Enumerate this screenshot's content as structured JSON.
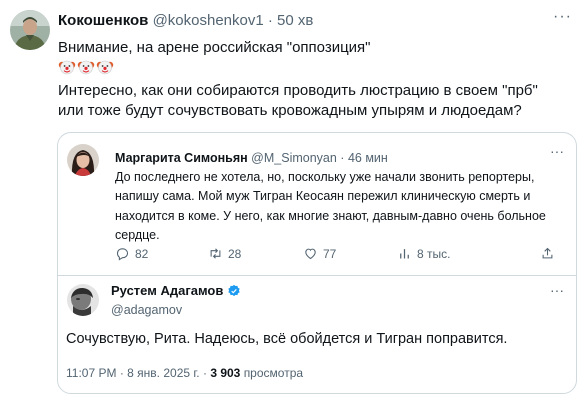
{
  "tweet": {
    "author_name": "Кокошенков",
    "author_handle": "@kokoshenkov1",
    "separator": "·",
    "time": "50 хв",
    "line1": "Внимание, на арене российская \"оппозиция\"",
    "emoji_icons": [
      "clown-face-icon",
      "clown-face-icon",
      "clown-face-icon"
    ],
    "line2": "Интересно, как они собираются проводить люстрацию в своем \"прб\"",
    "line3": "или тоже будут сочувствовать кровожадным упырям и людоедам?",
    "more_icon": "more-icon"
  },
  "quote": {
    "author_name": "Маргарита Симоньян",
    "author_handle": "@M_Simonyan",
    "separator": "·",
    "time": "46 мин",
    "lines": [
      "До последнего не хотела, но, поскольку уже начали звонить репортеры,",
      "напишу сама. Мой муж Тигран Кеосаян пережил клиническую смерть и",
      "находится в коме. У него, как многие знают, давным-давно очень больное",
      "сердце."
    ],
    "actions": {
      "replies": "82",
      "reposts": "28",
      "likes": "77",
      "views": "8 тыс."
    }
  },
  "reply": {
    "author_name": "Рустем Адагамов",
    "author_handle": "@adagamov",
    "text": "Сочувствую, Рита. Надеюсь, всё обойдется и Тигран поправится.",
    "time": "11:07 PM",
    "date": "8 янв. 2025 г.",
    "views_count": "3 903",
    "views_label": "просмотра",
    "meta_separator": "·"
  },
  "colors": {
    "text": "#0f1419",
    "muted": "#536471",
    "border": "#cfd9de",
    "verified": "#1d9bf0"
  }
}
